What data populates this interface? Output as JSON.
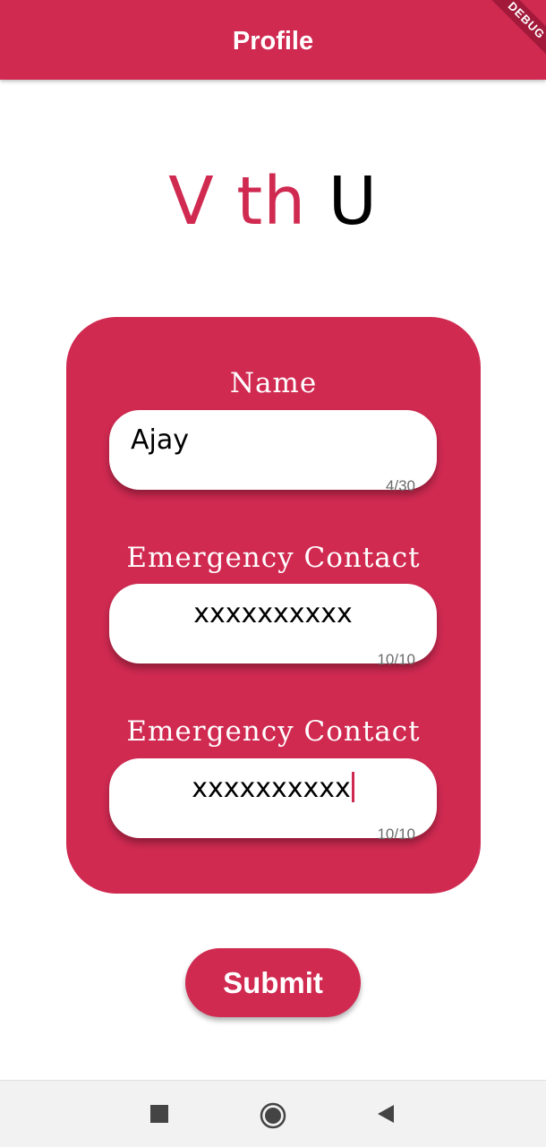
{
  "appbar": {
    "title": "Profile",
    "debug_banner": "DEBUG"
  },
  "logo": {
    "part1": "V th",
    "part2": "U",
    "colors": {
      "accent": "#d02a51",
      "dark": "#000000"
    }
  },
  "form": {
    "fields": [
      {
        "label": "Name",
        "value": "Ajay",
        "counter": "4/30"
      },
      {
        "label": "Emergency Contact",
        "value": "xxxxxxxxxx",
        "counter": "10/10"
      },
      {
        "label": "Emergency Contact",
        "value": "xxxxxxxxxx",
        "counter": "10/10"
      }
    ]
  },
  "submit_label": "Submit",
  "navbar": {
    "icons": [
      "recents-square-icon",
      "home-circle-icon",
      "back-triangle-icon"
    ]
  },
  "colors": {
    "primary": "#d02a51",
    "background": "#ffffff"
  }
}
